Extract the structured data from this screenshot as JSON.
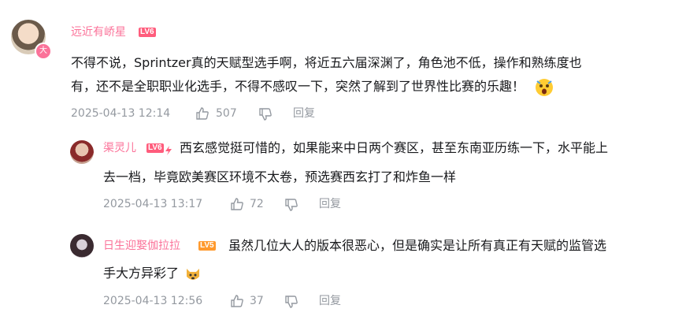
{
  "comments": [
    {
      "user": "远近有峤星",
      "level": "LV6",
      "level_color": "#ff5c7c",
      "name_color": "#fb7299",
      "text_line1": "不得不说，Sprintzer真的天赋型选手啊，将近五六届深渊了，角色池不低，操作和熟练度也",
      "text_line2": "有，还不是全职职业化选手，不得不感叹一下，突然了解到了世界性比赛的乐趣！",
      "emoji": "surprised-face",
      "date": "2025-04-13 12:14",
      "likes": "507",
      "reply_label": "回复"
    },
    {
      "user": "渠灵儿",
      "level": "LV6",
      "level_color": "#ff5c7c",
      "name_color": "#fb7299",
      "text_line1": "西玄感觉挺可惜的，如果能来中日两个赛区，甚至东南亚历练一下，水平能上",
      "text_line2": "去一档，毕竟欧美赛区环境不太卷，预选赛西玄打了和炸鱼一样",
      "date": "2025-04-13 13:17",
      "likes": "72",
      "reply_label": "回复"
    },
    {
      "user": "日生迎娶伽拉拉",
      "level": "LV5",
      "level_color": "#ff9a2e",
      "name_color": "#fb7299",
      "text_line1": "虽然几位大人的版本很恶心，但是确实是让所有真正有天赋的监管选",
      "text_line2": "手大方异彩了",
      "emoji": "dog-face",
      "date": "2025-04-13 12:56",
      "likes": "37",
      "reply_label": "回复"
    }
  ]
}
